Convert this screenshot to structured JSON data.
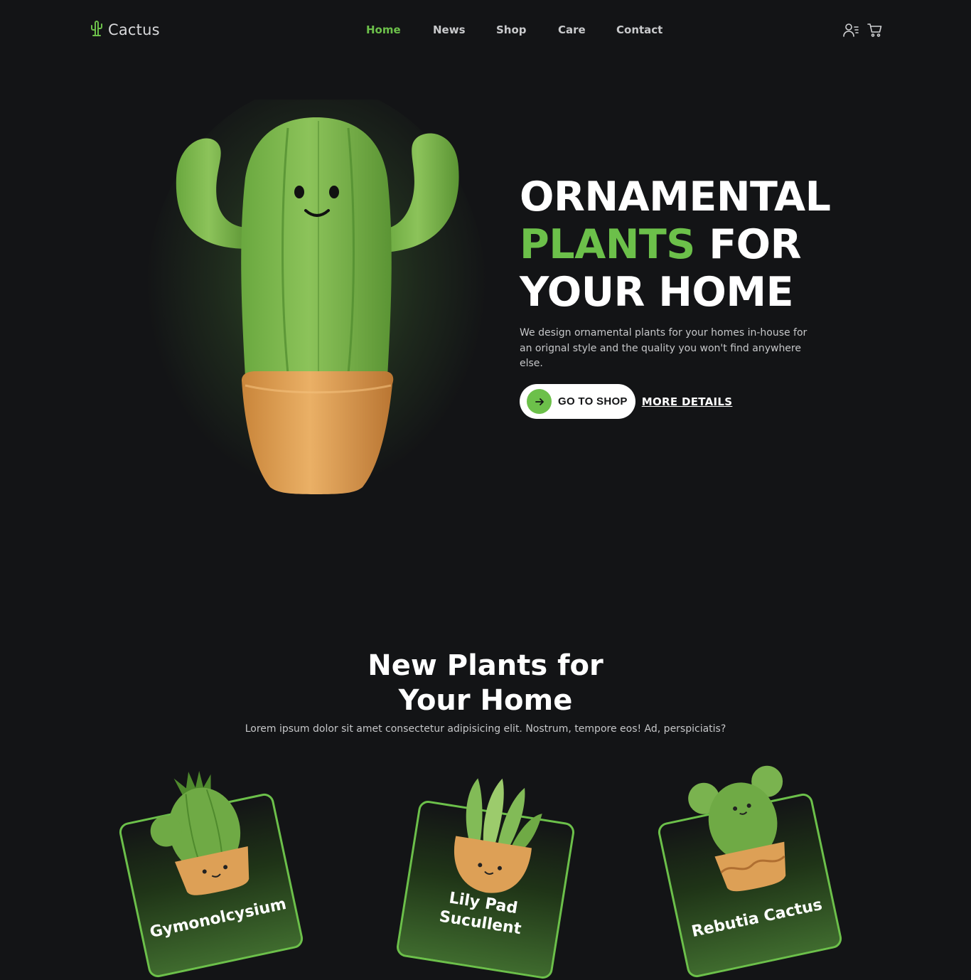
{
  "brand": {
    "name": "Cactus",
    "icon": "cactus-icon",
    "accent": "#6cc04a"
  },
  "nav": {
    "items": [
      {
        "label": "Home",
        "active": true
      },
      {
        "label": "News",
        "active": false
      },
      {
        "label": "Shop",
        "active": false
      },
      {
        "label": "Care",
        "active": false
      },
      {
        "label": "Contact",
        "active": false
      }
    ]
  },
  "header_icons": [
    "user-menu-icon",
    "cart-icon"
  ],
  "hero": {
    "title_line1": "ORNAMENTAL",
    "title_green": "PLANTS",
    "title_rest": " FOR",
    "title_line3": "YOUR HOME",
    "description": "We design ornamental plants for your homes in-house for an orignal style and the quality you won't find anywhere else.",
    "primary_button": "GO TO SHOP",
    "secondary_link": "MORE DETAILS",
    "art": "smiling-cactus-in-pot"
  },
  "new_plants": {
    "title_line1": "New Plants for",
    "title_line2": "Your Home",
    "subtitle": "Lorem ipsum dolor sit amet consectetur adipisicing elit. Nostrum, tempore eos! Ad, perspiciatis?",
    "cards": [
      {
        "name": "Gymonolcysium"
      },
      {
        "name": "Lily Pad Sucullent"
      },
      {
        "name": "Rebutia Cactus"
      }
    ]
  },
  "colors": {
    "background": "#131416",
    "accent_green": "#6cc04a",
    "text_light": "#c6c7c9",
    "pot": "#e0a352"
  }
}
